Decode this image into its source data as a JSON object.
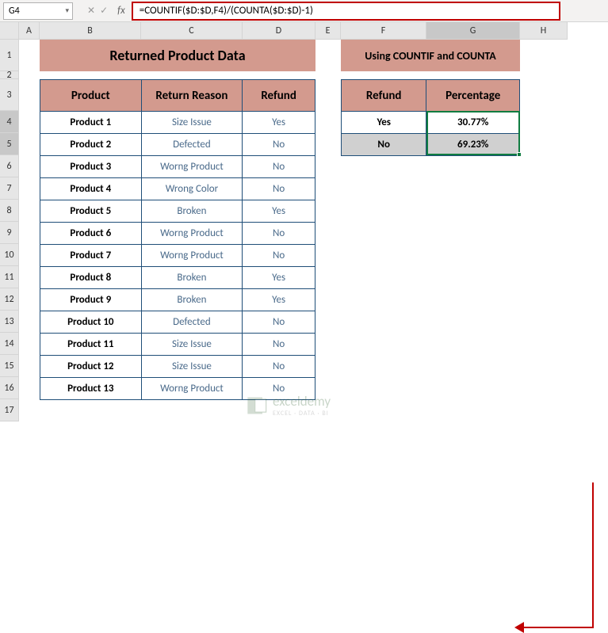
{
  "nameBox": "G4",
  "formula": "=COUNTIF($D:$D,F4)/(COUNTA($D:$D)-1)",
  "columns": [
    "A",
    "B",
    "C",
    "D",
    "E",
    "F",
    "G",
    "H"
  ],
  "rows": [
    "1",
    "2",
    "3",
    "4",
    "5",
    "6",
    "7",
    "8",
    "9",
    "10",
    "11",
    "12",
    "13",
    "14",
    "15",
    "16",
    "17"
  ],
  "title1": "Returned Product Data",
  "title2": "Using COUNTIF and COUNTA",
  "mainHeaders": {
    "product": "Product",
    "reason": "Return Reason",
    "refund": "Refund"
  },
  "mainRows": [
    {
      "product": "Product 1",
      "reason": "Size Issue",
      "refund": "Yes"
    },
    {
      "product": "Product 2",
      "reason": "Defected",
      "refund": "No"
    },
    {
      "product": "Product 3",
      "reason": "Worng Product",
      "refund": "No"
    },
    {
      "product": "Product 4",
      "reason": "Wrong Color",
      "refund": "No"
    },
    {
      "product": "Product 5",
      "reason": "Broken",
      "refund": "Yes"
    },
    {
      "product": "Product 6",
      "reason": "Worng Product",
      "refund": "No"
    },
    {
      "product": "Product 7",
      "reason": "Worng Product",
      "refund": "No"
    },
    {
      "product": "Product 8",
      "reason": "Broken",
      "refund": "Yes"
    },
    {
      "product": "Product 9",
      "reason": "Broken",
      "refund": "Yes"
    },
    {
      "product": "Product 10",
      "reason": "Defected",
      "refund": "No"
    },
    {
      "product": "Product 11",
      "reason": "Size Issue",
      "refund": "No"
    },
    {
      "product": "Product 12",
      "reason": "Size Issue",
      "refund": "No"
    },
    {
      "product": "Product 13",
      "reason": "Worng Product",
      "refund": "No"
    }
  ],
  "sideHeaders": {
    "refund": "Refund",
    "percentage": "Percentage"
  },
  "sideRows": [
    {
      "refund": "Yes",
      "percentage": "30.77%"
    },
    {
      "refund": "No",
      "percentage": "69.23%"
    }
  ],
  "watermark": {
    "text": "exceldemy",
    "sub": "EXCEL · DATA · BI"
  }
}
